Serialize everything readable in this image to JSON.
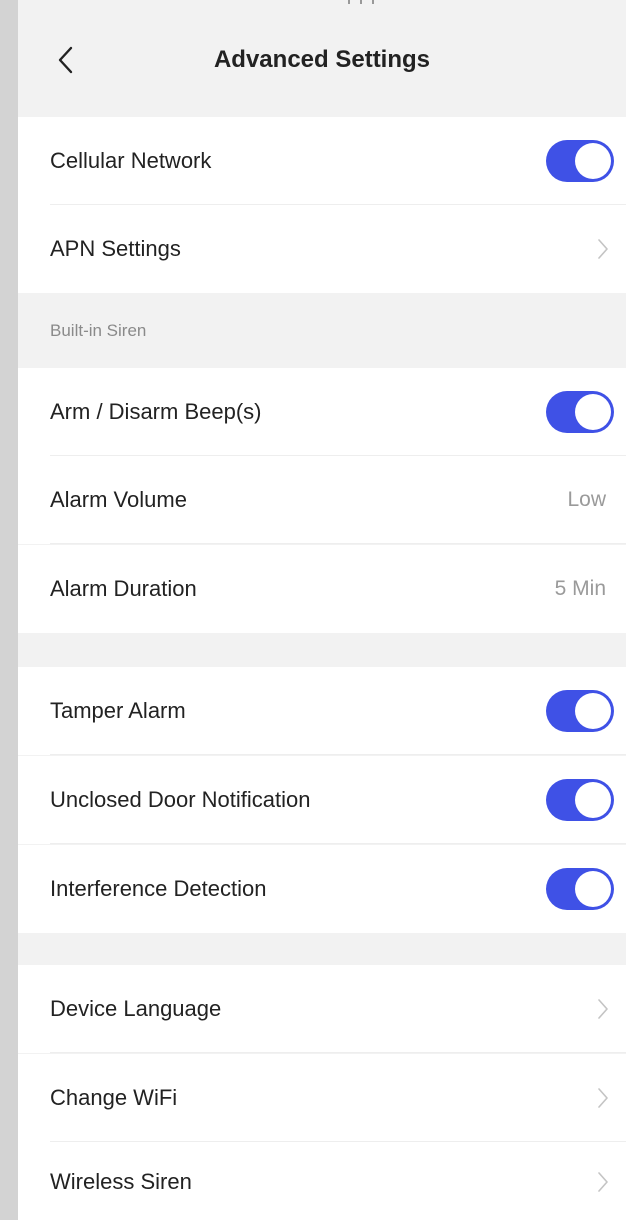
{
  "header": {
    "title": "Advanced Settings",
    "back_icon": "chevron-left-icon"
  },
  "colors": {
    "toggle_on": "#3f51e6",
    "background": "#f2f2f2",
    "row": "#ffffff"
  },
  "groups": [
    {
      "rows": [
        {
          "label": "Cellular Network",
          "control": "toggle",
          "on": true
        },
        {
          "label": "APN Settings",
          "control": "chevron"
        }
      ]
    },
    {
      "header": "Built-in Siren",
      "rows": [
        {
          "label": "Arm / Disarm Beep(s)",
          "control": "toggle",
          "on": true
        },
        {
          "label": "Alarm Volume",
          "control": "value",
          "value": "Low"
        },
        {
          "label": "Alarm Duration",
          "control": "value",
          "value": "5 Min"
        }
      ]
    },
    {
      "rows": [
        {
          "label": "Tamper Alarm",
          "control": "toggle",
          "on": true
        },
        {
          "label": "Unclosed Door Notification",
          "control": "toggle",
          "on": true
        },
        {
          "label": "Interference Detection",
          "control": "toggle",
          "on": true
        }
      ]
    },
    {
      "rows": [
        {
          "label": "Device Language",
          "control": "chevron"
        },
        {
          "label": "Change WiFi",
          "control": "chevron"
        },
        {
          "label": "Wireless Siren",
          "control": "chevron"
        }
      ]
    }
  ]
}
